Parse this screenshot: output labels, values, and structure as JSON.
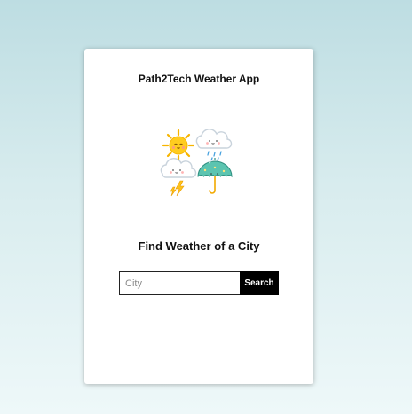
{
  "app": {
    "title": "Path2Tech Weather App",
    "subtitle": "Find Weather of a City"
  },
  "search": {
    "placeholder": "City",
    "value": "",
    "button_label": "Search"
  },
  "illustration": {
    "icons": [
      "sun-icon",
      "cloud-icon",
      "rain-icon",
      "lightning-icon",
      "umbrella-icon"
    ]
  },
  "colors": {
    "background_top": "#bddde2",
    "background_bottom": "#eef8f9",
    "card": "#ffffff",
    "button": "#000000",
    "button_text": "#ffffff"
  }
}
